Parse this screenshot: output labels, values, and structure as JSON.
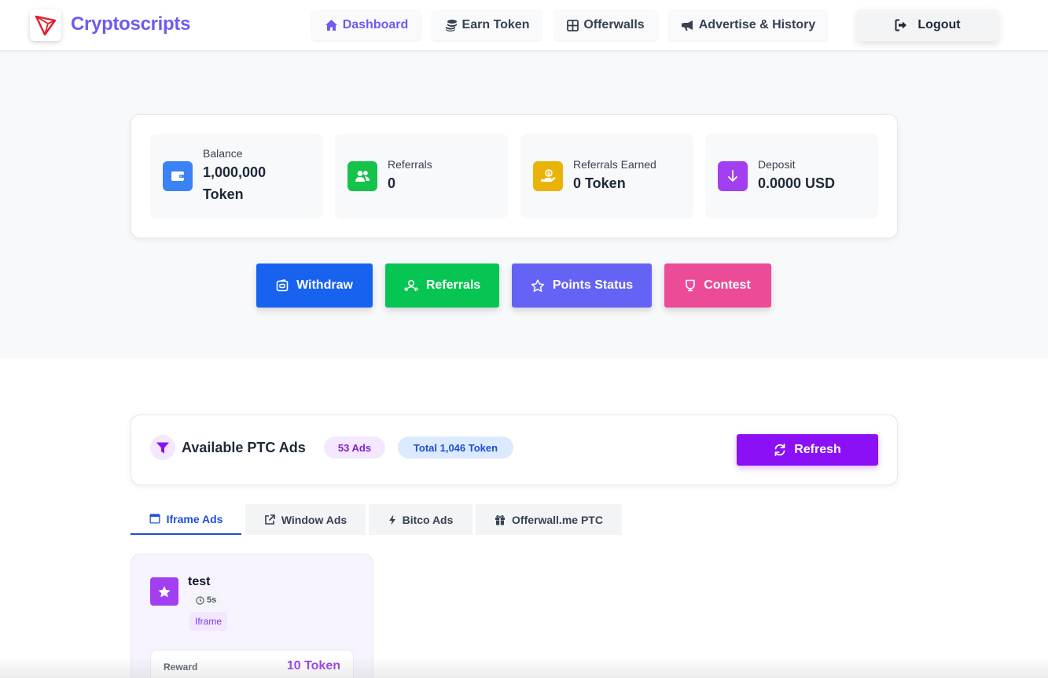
{
  "header": {
    "brand": "Cryptoscripts",
    "nav": [
      {
        "label": "Dashboard",
        "icon": "home-icon",
        "active": true
      },
      {
        "label": "Earn Token",
        "icon": "coins-icon"
      },
      {
        "label": "Offerwalls",
        "icon": "grid-icon"
      },
      {
        "label": "Advertise & History",
        "icon": "megaphone-icon"
      }
    ],
    "logout_label": "Logout"
  },
  "stats": [
    {
      "label": "Balance",
      "value_line1": "1,000,000",
      "value_line2": "Token",
      "icon": "wallet-icon",
      "color": "#3b82f6"
    },
    {
      "label": "Referrals",
      "value": "0",
      "icon": "users-icon",
      "color": "#16c34a"
    },
    {
      "label": "Referrals Earned",
      "value": "0 Token",
      "icon": "hand-coin-icon",
      "color": "#eab308"
    },
    {
      "label": "Deposit",
      "value": "0.0000 USD",
      "icon": "arrow-down-icon",
      "color": "#a23ff0"
    }
  ],
  "actions": [
    {
      "label": "Withdraw",
      "icon": "wallet-outline-icon",
      "color": "#1763f0"
    },
    {
      "label": "Referrals",
      "icon": "users-outline-icon",
      "color": "#06c553"
    },
    {
      "label": "Points Status",
      "icon": "star-outline-icon",
      "color": "#6563f5"
    },
    {
      "label": "Contest",
      "icon": "trophy-icon",
      "color": "#ec4b97"
    }
  ],
  "ptc": {
    "title": "Available PTC Ads",
    "ads_count": "53 Ads",
    "total": "Total 1,046 Token",
    "refresh_label": "Refresh"
  },
  "tabs": [
    {
      "label": "Iframe Ads",
      "icon": "window-icon",
      "active": true
    },
    {
      "label": "Window Ads",
      "icon": "external-link-icon"
    },
    {
      "label": "Bitco Ads",
      "icon": "bolt-icon"
    },
    {
      "label": "Offerwall.me PTC",
      "icon": "gift-icon"
    }
  ],
  "ad": {
    "title": "test",
    "duration": "5s",
    "type": "Iframe",
    "reward_label": "Reward",
    "reward_value": "10 Token"
  }
}
